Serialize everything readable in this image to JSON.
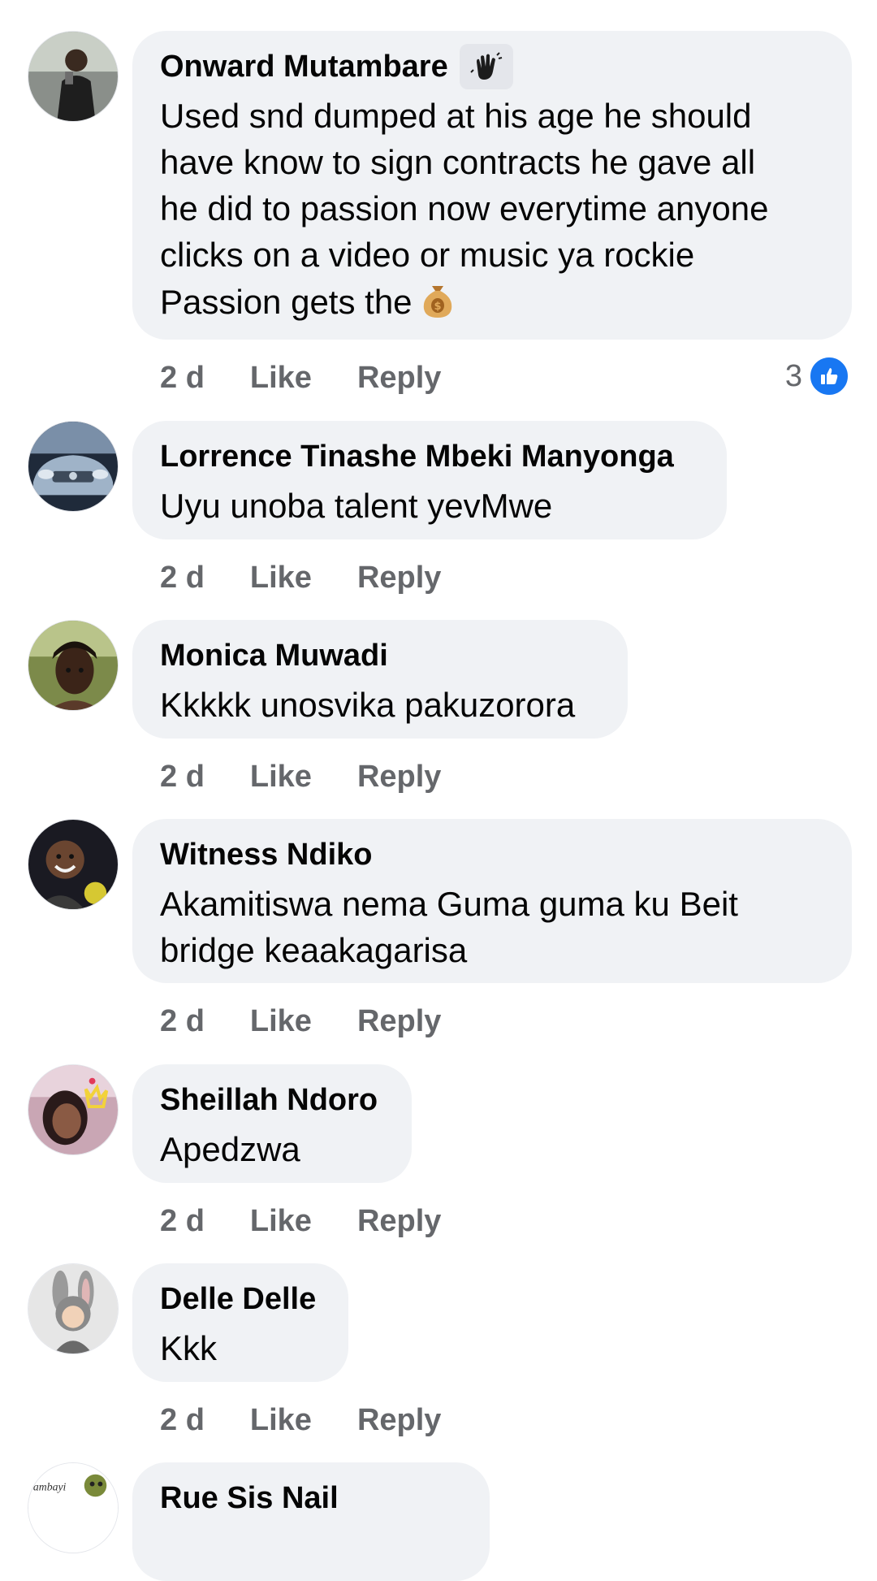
{
  "comments": [
    {
      "author": "Onward Mutambare",
      "badge_icon": "waving-hand-icon",
      "text": "Used snd dumped at his age he should\nhave know to sign contracts he gave all\nhe did to passion now everytime anyone\nclicks on a video or music ya rockie\nPassion gets the",
      "trailing_emoji": "money-bag-icon",
      "time": "2 d",
      "like_label": "Like",
      "reply_label": "Reply",
      "reaction_count": "3",
      "reaction_icon": "like-icon"
    },
    {
      "author": "Lorrence Tinashe Mbeki Manyonga",
      "text": "Uyu unoba talent yevMwe",
      "time": "2 d",
      "like_label": "Like",
      "reply_label": "Reply"
    },
    {
      "author": "Monica Muwadi",
      "text": "Kkkkk unosvika pakuzorora",
      "time": "2 d",
      "like_label": "Like",
      "reply_label": "Reply"
    },
    {
      "author": "Witness Ndiko",
      "text": "Akamitiswa nema Guma guma ku Beit\nbridge keaakagarisa",
      "time": "2 d",
      "like_label": "Like",
      "reply_label": "Reply"
    },
    {
      "author": "Sheillah Ndoro",
      "text": "Apedzwa",
      "time": "2 d",
      "like_label": "Like",
      "reply_label": "Reply"
    },
    {
      "author": "Delle Delle",
      "text": "Kkk",
      "time": "2 d",
      "like_label": "Like",
      "reply_label": "Reply"
    },
    {
      "author": "Rue Sis Nail",
      "avatar_text": "ambayi"
    }
  ],
  "colors": {
    "bubble": "#f0f2f5",
    "meta_text": "#65676b",
    "like_blue": "#1877f2"
  }
}
